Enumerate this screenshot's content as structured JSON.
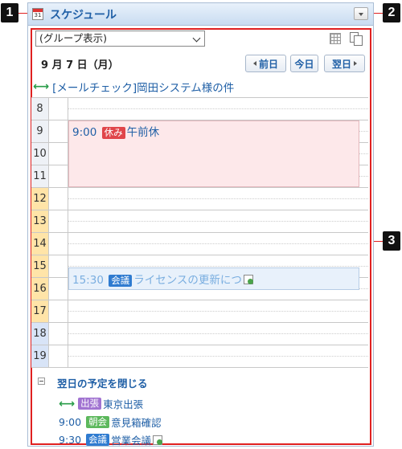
{
  "callouts": [
    "1",
    "2",
    "3"
  ],
  "portlet": {
    "title": "スケジュール",
    "calendar_icon_text": "31"
  },
  "toolbar": {
    "group_select_value": "(グループ表示)"
  },
  "date_nav": {
    "date_label": "9 月 7 日（月）",
    "prev_label": "前日",
    "today_label": "今日",
    "next_label": "翌日"
  },
  "all_day_event": "[メールチェック]岡田システム様の件",
  "hours": [
    "8",
    "9",
    "10",
    "11",
    "12",
    "13",
    "14",
    "15",
    "16",
    "17",
    "18",
    "19"
  ],
  "events": [
    {
      "time": "9:00",
      "tag": "休み",
      "tag_color": "#e0454a",
      "title": "午前休"
    },
    {
      "time": "15:30",
      "tag": "会議",
      "tag_color": "#2f7bd0",
      "title": "ライセンスの更新につ"
    }
  ],
  "next_day": {
    "toggle_label": "翌日の予定を閉じる",
    "items": [
      {
        "time": "",
        "tag": "出張",
        "tag_color": "#a173d1",
        "title": "東京出張"
      },
      {
        "time": "9:00",
        "tag": "朝会",
        "tag_color": "#5cb85c",
        "title": "意見箱確認"
      },
      {
        "time": "9:30",
        "tag": "会議",
        "tag_color": "#2f7bd0",
        "title": "営業会議"
      }
    ]
  },
  "colors": {
    "accent": "#1f5fa6",
    "annotation_red": "#e02020",
    "morning_hour": "#eef1f6",
    "afternoon_hour": "#ffe4a8",
    "evening_hour": "#d8e4f7"
  }
}
